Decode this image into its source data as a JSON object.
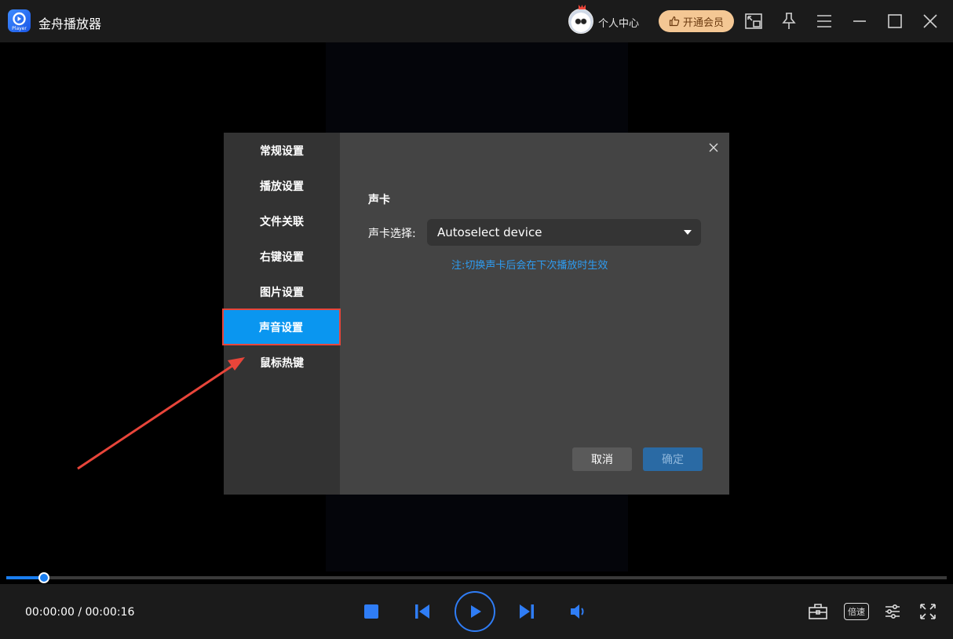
{
  "app": {
    "title": "金舟播放器",
    "logo_sub": "Player"
  },
  "header": {
    "user_center": "个人中心",
    "vip_label": "开通会员"
  },
  "dialog": {
    "menu": [
      {
        "label": "常规设置"
      },
      {
        "label": "播放设置"
      },
      {
        "label": "文件关联"
      },
      {
        "label": "右键设置"
      },
      {
        "label": "图片设置"
      },
      {
        "label": "声音设置",
        "active": true
      },
      {
        "label": "鼠标热键"
      }
    ],
    "section_title": "声卡",
    "device_label": "声卡选择:",
    "device_value": "Autoselect device",
    "note": "注:切换声卡后会在下次播放时生效",
    "cancel_label": "取消",
    "ok_label": "确定"
  },
  "player": {
    "time": "00:00:00 / 00:00:16",
    "progress": 0.04,
    "speed_label": "倍速"
  },
  "colors": {
    "accent": "#2f7df6",
    "active_item": "#0a96f0",
    "annotation": "#e8453a",
    "note": "#2e9cf1"
  }
}
